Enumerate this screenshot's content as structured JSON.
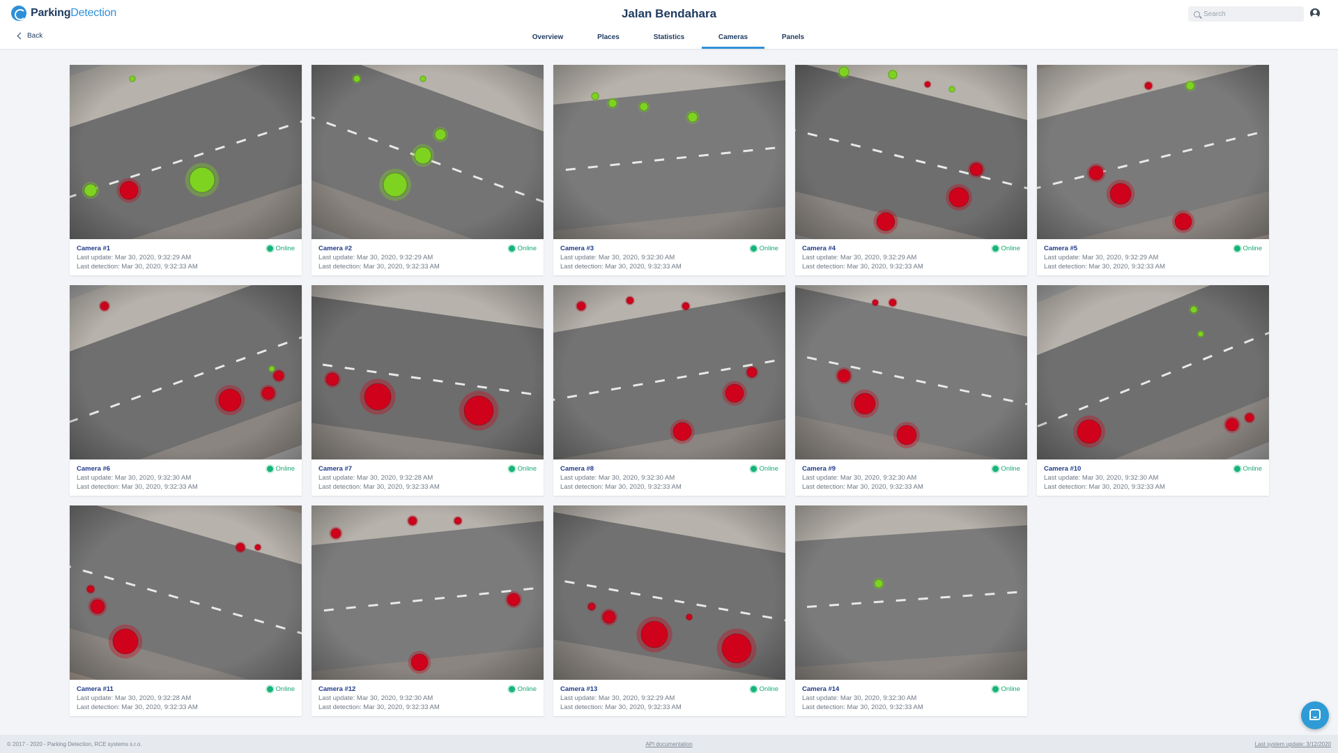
{
  "header": {
    "logo_bold": "Parking",
    "logo_light": "Detection",
    "title": "Jalan Bendahara",
    "search_placeholder": "Search",
    "back_label": "Back"
  },
  "tabs": [
    {
      "label": "Overview"
    },
    {
      "label": "Places"
    },
    {
      "label": "Statistics"
    },
    {
      "label": "Cameras",
      "active": true
    },
    {
      "label": "Panels"
    }
  ],
  "colors": {
    "accent": "#2e8fd8",
    "online": "#17b47a",
    "spot_free": "#7ed321",
    "spot_occupied": "#d0021b"
  },
  "cameras": [
    {
      "name": "Camera #1",
      "status": "Online",
      "last_update": "Last update: Mar 30, 2020, 9:32:29 AM",
      "last_detection": "Last detection: Mar 30, 2020, 9:32:33 AM"
    },
    {
      "name": "Camera #2",
      "status": "Online",
      "last_update": "Last update: Mar 30, 2020, 9:32:29 AM",
      "last_detection": "Last detection: Mar 30, 2020, 9:32:33 AM"
    },
    {
      "name": "Camera #3",
      "status": "Online",
      "last_update": "Last update: Mar 30, 2020, 9:32:30 AM",
      "last_detection": "Last detection: Mar 30, 2020, 9:32:33 AM"
    },
    {
      "name": "Camera #4",
      "status": "Online",
      "last_update": "Last update: Mar 30, 2020, 9:32:29 AM",
      "last_detection": "Last detection: Mar 30, 2020, 9:32:33 AM"
    },
    {
      "name": "Camera #5",
      "status": "Online",
      "last_update": "Last update: Mar 30, 2020, 9:32:29 AM",
      "last_detection": "Last detection: Mar 30, 2020, 9:32:33 AM"
    },
    {
      "name": "Camera #6",
      "status": "Online",
      "last_update": "Last update: Mar 30, 2020, 9:32:30 AM",
      "last_detection": "Last detection: Mar 30, 2020, 9:32:33 AM"
    },
    {
      "name": "Camera #7",
      "status": "Online",
      "last_update": "Last update: Mar 30, 2020, 9:32:28 AM",
      "last_detection": "Last detection: Mar 30, 2020, 9:32:33 AM"
    },
    {
      "name": "Camera #8",
      "status": "Online",
      "last_update": "Last update: Mar 30, 2020, 9:32:30 AM",
      "last_detection": "Last detection: Mar 30, 2020, 9:32:33 AM"
    },
    {
      "name": "Camera #9",
      "status": "Online",
      "last_update": "Last update: Mar 30, 2020, 9:32:30 AM",
      "last_detection": "Last detection: Mar 30, 2020, 9:32:33 AM"
    },
    {
      "name": "Camera #10",
      "status": "Online",
      "last_update": "Last update: Mar 30, 2020, 9:32:30 AM",
      "last_detection": "Last detection: Mar 30, 2020, 9:32:33 AM"
    },
    {
      "name": "Camera #11",
      "status": "Online",
      "last_update": "Last update: Mar 30, 2020, 9:32:28 AM",
      "last_detection": "Last detection: Mar 30, 2020, 9:32:33 AM"
    },
    {
      "name": "Camera #12",
      "status": "Online",
      "last_update": "Last update: Mar 30, 2020, 9:32:30 AM",
      "last_detection": "Last detection: Mar 30, 2020, 9:32:33 AM"
    },
    {
      "name": "Camera #13",
      "status": "Online",
      "last_update": "Last update: Mar 30, 2020, 9:32:29 AM",
      "last_detection": "Last detection: Mar 30, 2020, 9:32:33 AM"
    },
    {
      "name": "Camera #14",
      "status": "Online",
      "last_update": "Last update: Mar 30, 2020, 9:32:30 AM",
      "last_detection": "Last detection: Mar 30, 2020, 9:32:33 AM"
    }
  ],
  "footer": {
    "copyright": "© 2017 - 2020 - Parking Detection, RCE systems s.r.o.",
    "api_link": "API documentation",
    "system_update": "Last system update: 3/12/2020"
  }
}
